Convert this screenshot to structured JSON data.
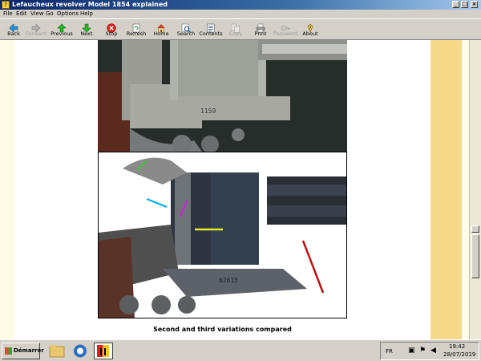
{
  "window": {
    "title": "Lefaucheux revolver Model 1854 explained",
    "controls": [
      "_",
      "□",
      "×"
    ]
  },
  "menu": [
    "File",
    "Edit",
    "View",
    "Go",
    "Options",
    "Help"
  ],
  "toolbar": {
    "back": "Back",
    "forward": "Forward",
    "previous": "Previous",
    "next": "Next",
    "stop": "Stop",
    "refresh": "Refresh",
    "home": "Home",
    "search": "Search",
    "contents": "Contents",
    "copy": "Copy",
    "print": "Print",
    "password": "Password",
    "about": "About"
  },
  "document": {
    "serial_top": "1159",
    "serial_bottom": "62615",
    "caption": "Second and third variations compared"
  },
  "taskbar": {
    "start": "Démarrer",
    "language": "FR",
    "time": "19:42",
    "date": "28/07/2019"
  }
}
